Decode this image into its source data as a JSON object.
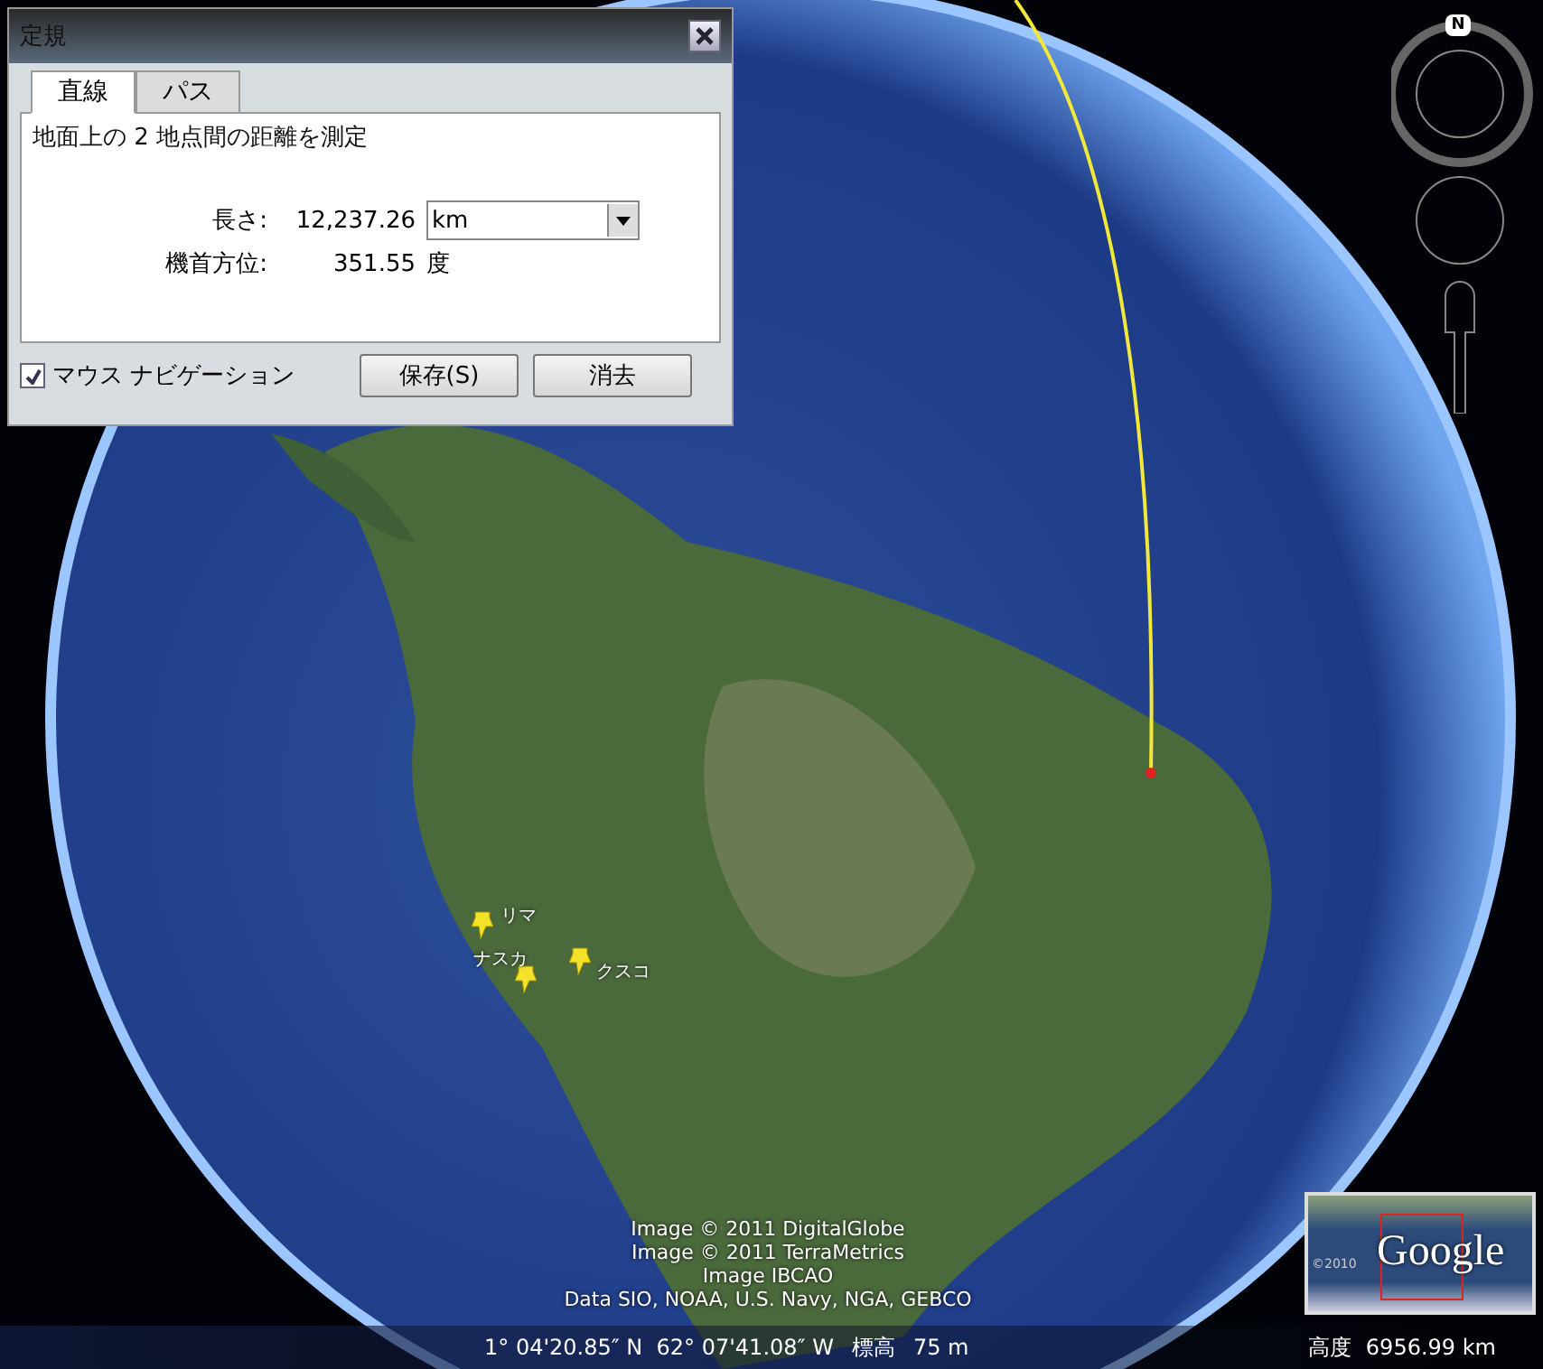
{
  "ruler_dialog": {
    "title": "定規",
    "tabs": [
      {
        "label": "直線",
        "selected": true
      },
      {
        "label": "パス",
        "selected": false
      }
    ],
    "description": "地面上の 2 地点間の距離を測定",
    "measurements": [
      {
        "kind": "select",
        "label": "長さ:",
        "value": "12,237.26",
        "unit": "km"
      },
      {
        "kind": "text",
        "label": "機首方位:",
        "value": "351.55",
        "unit": "度"
      }
    ],
    "mouse_navigation": {
      "label": "マウス ナビゲーション",
      "checked": true
    },
    "buttons": [
      "保存(S)",
      "消去"
    ]
  },
  "places": [
    {
      "name": "リマ"
    },
    {
      "name": "ナスカ"
    },
    {
      "name": "クスコ"
    }
  ],
  "compass": {
    "north": "N"
  },
  "attributions": [
    "Image © 2011 DigitalGlobe",
    "Image © 2011 TerraMetrics",
    "Image IBCAO",
    "Data SIO, NOAA, U.S. Navy, NGA, GEBCO"
  ],
  "overview_map": {
    "logo": "Google",
    "year": "©2010"
  },
  "status_bar": {
    "coordinates": "1° 04'20.85″ N  62° 07'41.08″ W",
    "elevation_label": "標高",
    "elevation": "75 m",
    "altitude_label": "高度",
    "altitude": "6956.99 km"
  }
}
